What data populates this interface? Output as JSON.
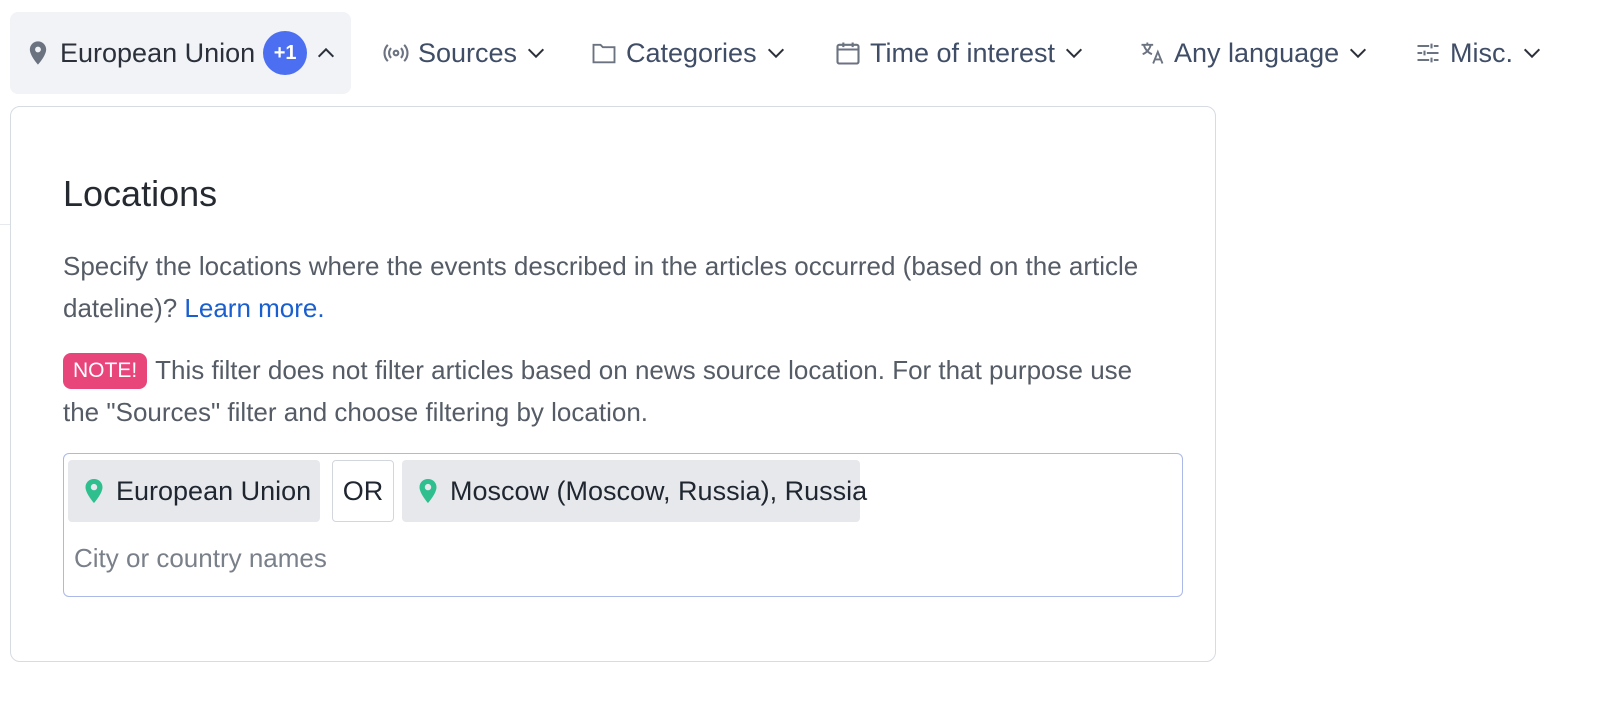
{
  "filters": [
    {
      "label": "European Union",
      "badge": "+1",
      "icon": "map-pin-icon",
      "chevron": "up"
    },
    {
      "label": "Sources",
      "icon": "broadcast-icon",
      "chevron": "down"
    },
    {
      "label": "Categories",
      "icon": "folder-icon",
      "chevron": "down"
    },
    {
      "label": "Time of interest",
      "icon": "calendar-icon",
      "chevron": "down"
    },
    {
      "label": "Any language",
      "icon": "translate-icon",
      "chevron": "down"
    },
    {
      "label": "Misc.",
      "icon": "sliders-icon",
      "chevron": "down"
    }
  ],
  "popover": {
    "title": "Locations",
    "description": "Specify the locations where the events described in the articles occurred (based on the article dateline)? ",
    "learn_more": "Learn more.",
    "note_badge": "NOTE!",
    "note_text": "This filter does not filter articles based on news source location. For that purpose use the \"Sources\" filter and choose filtering by location.",
    "chips": [
      {
        "label": "European Union",
        "icon": "map-pin-icon"
      },
      {
        "label": "Moscow (Moscow, Russia), Russia",
        "icon": "map-pin-icon"
      }
    ],
    "operator": "OR",
    "input_placeholder": "City or country names"
  },
  "colors": {
    "accent": "#4c6ef0",
    "link": "#1a5fd0",
    "note": "#e8457b",
    "pin": "#2fbf8f",
    "input_border": "#aab8ea"
  }
}
